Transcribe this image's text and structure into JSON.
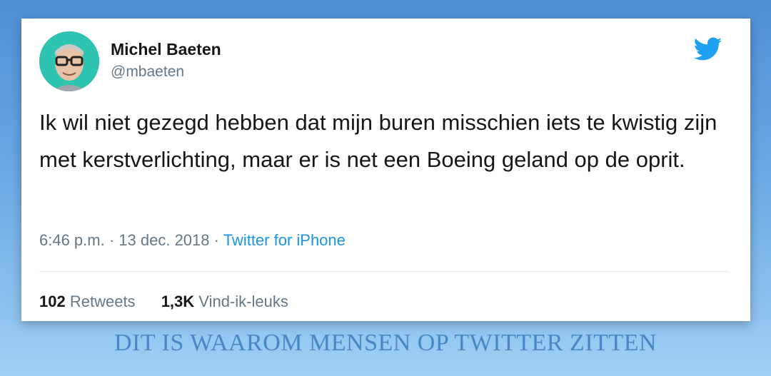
{
  "tweet": {
    "author_name": "Michel Baeten",
    "author_handle": "@mbaeten",
    "text": "Ik wil niet gezegd hebben dat mijn buren misschien iets te kwistig zijn met kerstverlichting, maar er is net een Boeing geland op de oprit.",
    "time": "6:46 p.m.",
    "date": "13 dec. 2018",
    "separator": "·",
    "source": "Twitter for iPhone",
    "retweets_count": "102",
    "retweets_label": "Retweets",
    "likes_count": "1,3K",
    "likes_label": "Vind-ik-leuks",
    "avatar_icon": "cartoon-avatar",
    "logo_icon": "twitter-bird-icon"
  },
  "caption": "DIT IS WAAROM MENSEN OP TWITTER ZITTEN",
  "colors": {
    "twitter_blue": "#1b95e0",
    "secondary_text": "#657786",
    "caption": "#4a86c4"
  }
}
